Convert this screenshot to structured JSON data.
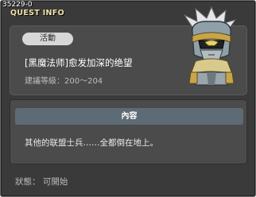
{
  "quest_id": "35229-0",
  "window_title": "QUEST INFO",
  "category": "活動",
  "quest_title": "[黑魔法师]愈发加深的绝望",
  "level_range": "建議等級：200～204",
  "content_header": "內容",
  "content_text": "其他的联盟士兵……全都倒在地上。",
  "status": "狀態： 可開始",
  "npc_icon": "npc-knight-portrait-icon",
  "colors": {
    "window_bg": "#3a3a3a",
    "panel_bg": "#4b4b4b",
    "header_bar": "#5c6b74",
    "title_gold": "#f0e2a8",
    "badge_bg": "#d7d7d7"
  }
}
